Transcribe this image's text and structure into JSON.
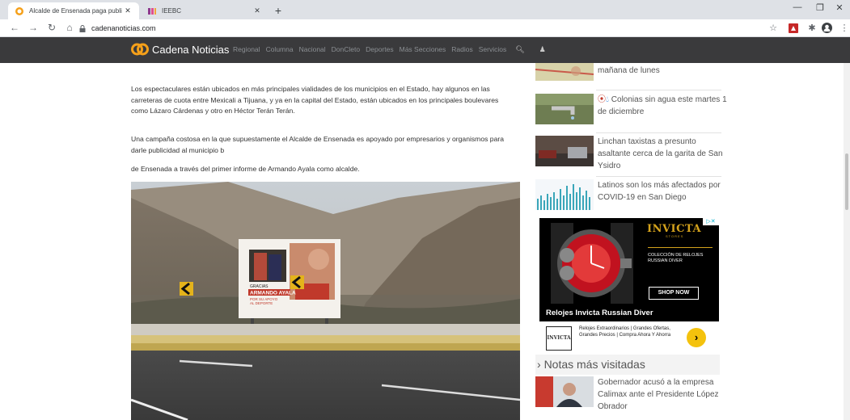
{
  "browser": {
    "tabs": [
      {
        "title": "Alcalde de Ensenada paga publi",
        "active": true
      },
      {
        "title": "IEEBC",
        "active": false
      }
    ],
    "new_tab": "+",
    "url": "cadenanoticias.com",
    "window_controls": {
      "minimize": "—",
      "restore": "❐",
      "close": "✕"
    }
  },
  "site": {
    "brand": "Cadena Noticias",
    "menu": [
      "Regional",
      "Columna",
      "Nacional",
      "DonCleto",
      "Deportes",
      "Más Secciones",
      "Radios",
      "Servicios"
    ],
    "colors": {
      "nav_bg": "#3a3a3c",
      "logo_orange": "#f5a01a"
    }
  },
  "article": {
    "paragraphs": [
      "Los espectaculares están ubicados en más principales vialidades de los municipios en el Estado, hay algunos en las carreteras de cuota entre Mexicali a Tijuana, y ya en la capital del Estado, están ubicados en los principales boulevares como Lázaro Cárdenas y otro en Héctor Terán Terán.",
      "Una campaña costosa en la que supuestamente el Alcalde de Ensenada es apoyado por empresarios y organismos para darle publicidad al municipio b",
      "de Ensenada a través del primer informe de Armando Ayala como alcalde."
    ],
    "billboard": {
      "line1": "GRACIAS",
      "line2": "ARMANDO AYALA",
      "line3": "POR SU APOYO",
      "line4": "AL DEPORTE"
    }
  },
  "sidebar": {
    "items": [
      {
        "title": "mañana de lunes"
      },
      {
        "title": "Colonias sin agua este martes 1 de diciembre"
      },
      {
        "title": "Linchan taxistas a presunto asaltante cerca de la garita de San Ysidro"
      },
      {
        "title": "Latinos son los más afectados por COVID-19 en San Diego"
      }
    ],
    "ad": {
      "brand": "INVICTA",
      "stores": "STORES",
      "collection": "COLECCIÓN DE RELOJES RUSSIAN DIVER",
      "cta": "SHOP NOW",
      "headline": "Relojes Invicta Russian Diver",
      "small_logo": "INVICTA",
      "description": "Relojes Extraordinarios | Grandes Ofertas, Grandes Precios | Compra Ahora Y Ahorra",
      "adchoice": "▷✕"
    },
    "notas_title": "Notas más visitadas",
    "most_visited": [
      {
        "title": "Gobernador acusó a la empresa Calimax ante el Presidente López Obrador"
      }
    ]
  }
}
